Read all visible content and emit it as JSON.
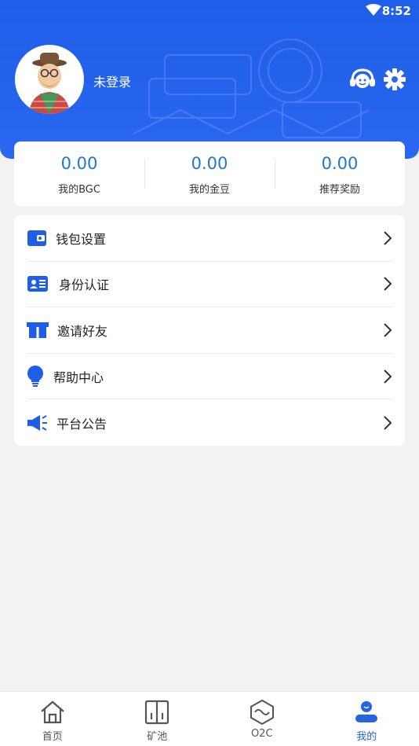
{
  "status_bar": {
    "time": "8:52"
  },
  "profile": {
    "username": "未登录"
  },
  "stats": [
    {
      "value": "0.00",
      "label": "我的BGC"
    },
    {
      "value": "0.00",
      "label": "我的金豆"
    },
    {
      "value": "0.00",
      "label": "推荐奖励"
    }
  ],
  "menu": [
    {
      "label": "钱包设置",
      "icon": "wallet-icon"
    },
    {
      "label": "身份认证",
      "icon": "id-card-icon"
    },
    {
      "label": "邀请好友",
      "icon": "gift-icon"
    },
    {
      "label": "帮助中心",
      "icon": "lightbulb-icon"
    },
    {
      "label": "平台公告",
      "icon": "megaphone-icon"
    }
  ],
  "tabbar": [
    {
      "label": "首页",
      "icon": "home-icon"
    },
    {
      "label": "矿池",
      "icon": "mining-pool-icon"
    },
    {
      "label": "O2C",
      "icon": "exchange-icon"
    },
    {
      "label": "我的",
      "icon": "user-icon",
      "active": true
    }
  ],
  "colors": {
    "header_blue": "#1f5ee8",
    "accent_blue": "#2563e0",
    "stat_value": "#1e76d6"
  }
}
